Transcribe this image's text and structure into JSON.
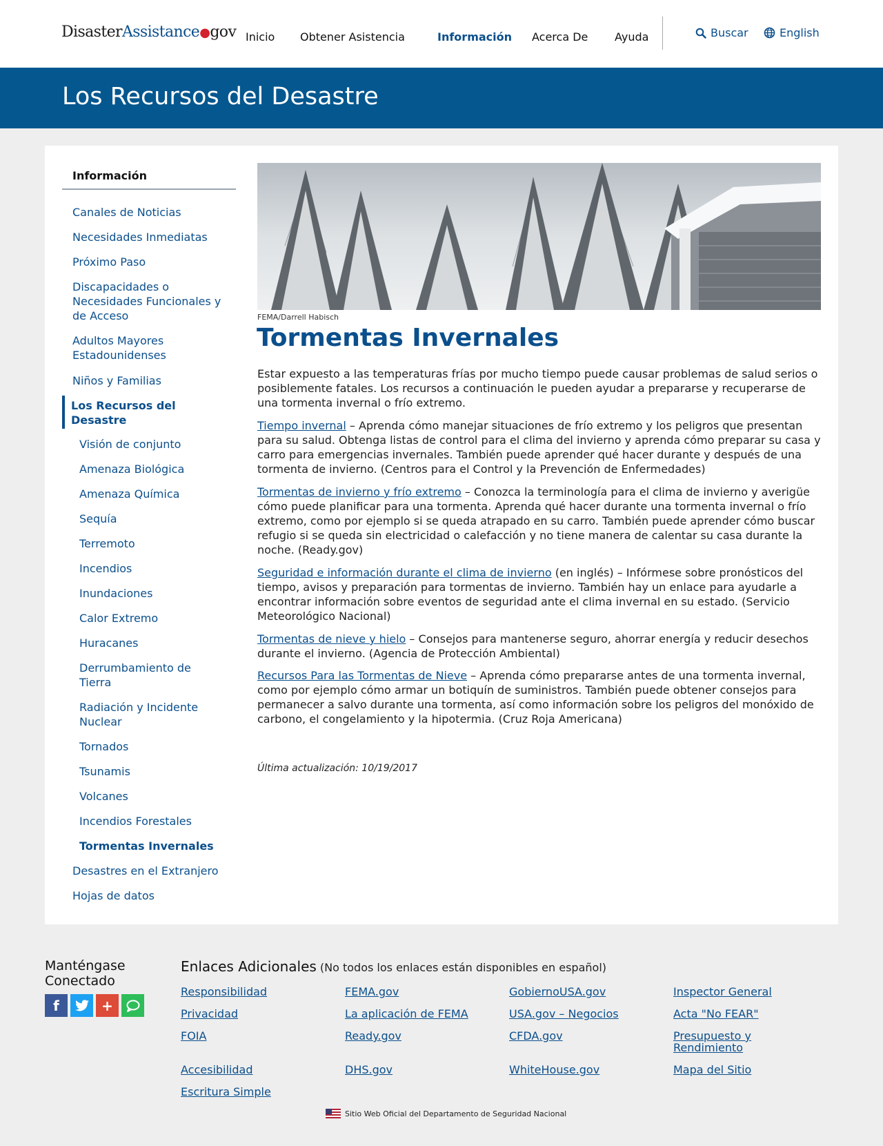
{
  "header": {
    "logo_part1": "Disaster",
    "logo_part2": "Assistance",
    "logo_dot": "●",
    "logo_part3": "gov",
    "nav": [
      "Inicio",
      "Obtener Asistencia",
      "Información",
      "Acerca De",
      "Ayuda"
    ],
    "search_label": "Buscar",
    "language_label": "English",
    "search_icon": "search-icon",
    "language_icon": "globe-icon"
  },
  "banner": {
    "title": "Los Recursos del Desastre"
  },
  "sidebar": {
    "heading": "Información",
    "items": [
      "Canales de Noticias",
      "Necesidades Inmediatas",
      "Próximo Paso",
      "Discapacidades o Necesidades Funcionales y de Acceso",
      "Adultos Mayores Estadounidenses",
      "Niños y Familias",
      "Los Recursos del Desastre",
      "Visión de conjunto",
      "Amenaza Biológica",
      "Amenaza Química",
      "Sequía",
      "Terremoto",
      "Incendios",
      "Inundaciones",
      "Calor Extremo",
      "Huracanes",
      "Derrumbamiento de Tierra",
      "Radiación y Incidente Nuclear",
      "Tornados",
      "Tsunamis",
      "Volcanes",
      "Incendios Forestales",
      "Tormentas Invernales",
      "Desastres en el Extranjero",
      "Hojas de datos"
    ]
  },
  "content": {
    "image_credit": "FEMA/Darrell Habisch",
    "title": "Tormentas Invernales",
    "intro": "Estar expuesto a las temperaturas frías por mucho tiempo puede causar problemas de salud serios o posiblemente fatales. Los recursos a continuación le pueden ayudar a prepararse y recuperarse de una tormenta invernal o frío extremo.",
    "resources": [
      {
        "link": "Tiempo invernal",
        "text": " – Aprenda cómo manejar situaciones de frío extremo y los peligros que presentan para su salud. Obtenga listas de control para el clima del invierno y aprenda cómo preparar su casa y carro para emergencias invernales. También puede aprender qué hacer durante y después de una tormenta de invierno. (Centros para el Control y la Prevención de Enfermedades)"
      },
      {
        "link": "Tormentas de invierno y frío extremo",
        "text": " – Conozca la terminología para el clima de invierno y averigüe cómo puede planificar para una tormenta. Aprenda qué hacer durante una tormenta invernal o frío extremo, como por ejemplo si se queda atrapado en su carro. También puede aprender cómo buscar refugio si se queda sin electricidad o calefacción y no tiene manera de calentar su casa durante la noche. (Ready.gov)"
      },
      {
        "link": "Seguridad e información durante el clima de invierno",
        "text": " (en inglés) – Infórmese sobre pronósticos del tiempo, avisos y preparación para tormentas de invierno. También hay un enlace para ayudarle a encontrar información sobre eventos de seguridad ante el clima invernal en su estado. (Servicio Meteorológico Nacional)"
      },
      {
        "link": "Tormentas de nieve y hielo",
        "text": " – Consejos para mantenerse seguro, ahorrar energía y reducir desechos durante el invierno. (Agencia de Protección Ambiental)"
      },
      {
        "link": "Recursos Para las Tormentas de Nieve",
        "text": " – Aprenda cómo prepararse antes de una tormenta invernal, como por ejemplo cómo armar un botiquín de suministros. También puede obtener consejos para permanecer a salvo durante una tormenta, así como información sobre los peligros del monóxido de carbono, el congelamiento y la hipotermia. (Cruz Roja Americana)"
      }
    ],
    "last_updated": "Última actualización: 10/19/2017"
  },
  "footer": {
    "connect_title": "Manténgase Conectado",
    "social": [
      {
        "icon": "facebook-icon",
        "glyph": "f",
        "color": "#3b5998"
      },
      {
        "icon": "twitter-icon",
        "glyph": "✦",
        "color": "#1da1f2"
      },
      {
        "icon": "plus-icon",
        "glyph": "+",
        "color": "#dd4b39"
      },
      {
        "icon": "chat-icon",
        "glyph": "💬",
        "color": "#2ebd59"
      }
    ],
    "links_title": "Enlaces Adicionales",
    "links_note": "(No todos los enlaces están disponibles en español)",
    "links": [
      [
        "Responsibilidad",
        "FEMA.gov",
        "GobiernoUSA.gov",
        "Inspector General"
      ],
      [
        "Privacidad",
        "La aplicación de FEMA",
        "USA.gov – Negocios",
        "Acta \"No FEAR\""
      ],
      [
        "FOIA",
        "Ready.gov",
        "CFDA.gov",
        "Presupuesto y Rendimiento"
      ],
      [
        "Accesibilidad",
        "DHS.gov",
        "WhiteHouse.gov",
        "Mapa del Sitio"
      ],
      [
        "Escritura Simple"
      ]
    ],
    "official_text": "Sitio Web Oficial del Departamento de Seguridad Nacional",
    "flag_icon": "us-flag-icon"
  },
  "colors": {
    "brand_blue": "#05578f",
    "link_blue": "#0b4f8c",
    "logo_red": "#d2222d"
  }
}
